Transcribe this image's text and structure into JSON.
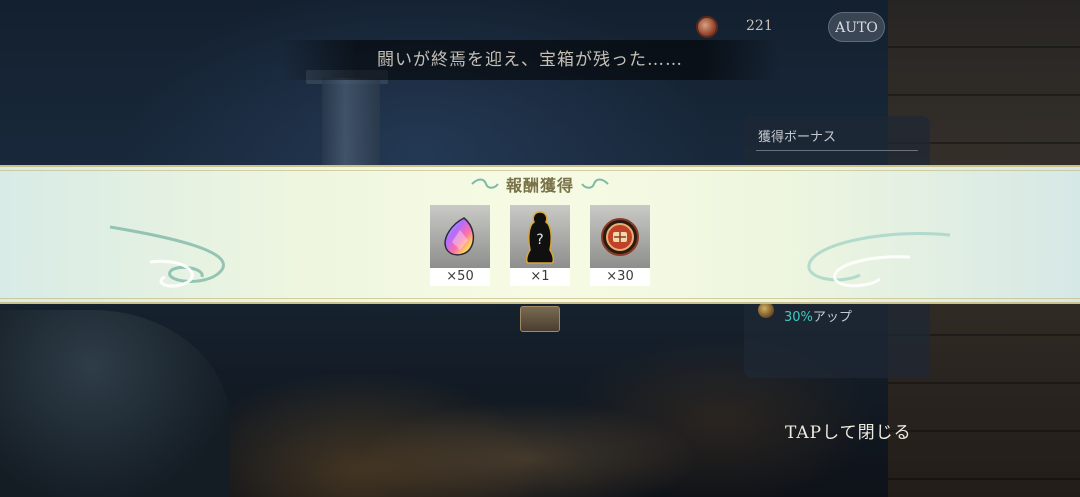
{
  "hud": {
    "coin_count": "221",
    "auto_label": "AUTO"
  },
  "battle_message": "闘いが終焉を迎え、宝箱が残った……",
  "bonus_panel": {
    "title": "獲得ボーナス",
    "rate_pct": "30%",
    "rate_suffix": "アップ"
  },
  "reward": {
    "title": "報酬獲得",
    "items": [
      {
        "icon": "rainbow-crystal-icon",
        "qty": "×50"
      },
      {
        "icon": "mystery-character-icon",
        "qty": "×1"
      },
      {
        "icon": "medal-coin-icon",
        "qty": "×30"
      }
    ]
  },
  "tap_to_close": "TAPして閉じる",
  "colors": {
    "strip_border": "#c9c08c",
    "title_text": "#7a7248",
    "teal_accent": "#3fc9c0"
  }
}
